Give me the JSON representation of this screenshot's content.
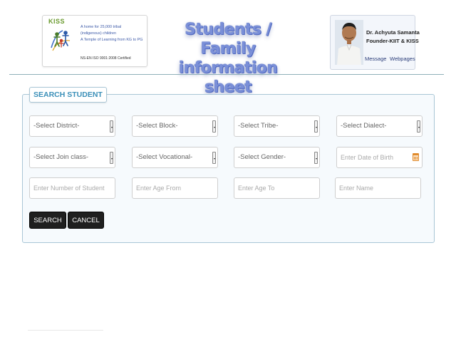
{
  "header": {
    "logo": {
      "brand": "KISS",
      "lines": [
        "A home for 25,000 tribal",
        "(indigenous) children",
        "A Temple of Learning from KG to PG"
      ],
      "cert": "NS-EN ISO 9001:2008 Certified"
    },
    "title": [
      "Students / Family",
      "information sheet"
    ],
    "profile": {
      "name_line1": "Dr. Achyuta Samanta",
      "name_line2": "Founder-KIIT & KISS",
      "message_link": "Message",
      "webpages_link": "Webpages"
    }
  },
  "search": {
    "legend": "SEARCH STUDENT",
    "selects": {
      "district": "-Select District-",
      "block": "-Select Block-",
      "tribe": "-Select Tribe-",
      "dialect": "-Select Dialect-",
      "join_class": "-Select Join class-",
      "vocational": "-Select Vocational-",
      "gender": "-Select Gender-"
    },
    "inputs": {
      "dob_placeholder": "Enter Date of Birth",
      "number_placeholder": "Enter Number of Student",
      "age_from_placeholder": "Enter Age From",
      "age_to_placeholder": "Enter Age To",
      "name_placeholder": "Enter Name"
    },
    "buttons": {
      "search": "SEARCH",
      "cancel": "CANCEL"
    }
  },
  "colors": {
    "accent": "#3a8fb8",
    "title": "#7a8fd8",
    "button": "#1f1f1f",
    "calendar_icon": "#e08a2a"
  }
}
